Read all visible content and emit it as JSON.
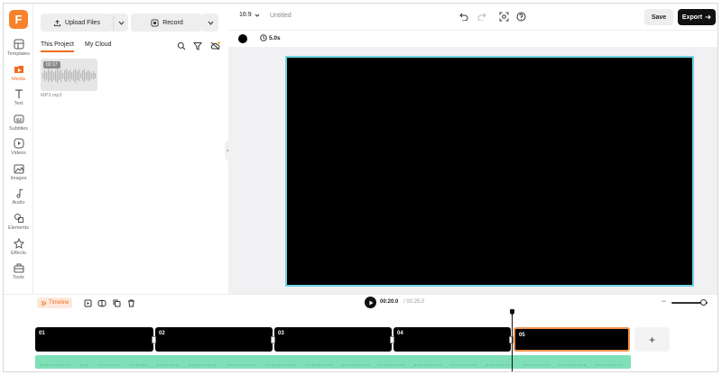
{
  "app": {
    "logo": "F"
  },
  "sidebar": {
    "items": [
      {
        "label": "Templates",
        "icon": "templates-icon"
      },
      {
        "label": "Media",
        "icon": "media-icon",
        "active": true
      },
      {
        "label": "Text",
        "icon": "text-icon"
      },
      {
        "label": "Subtitles",
        "icon": "subtitles-icon"
      },
      {
        "label": "Videos",
        "icon": "videos-icon"
      },
      {
        "label": "Images",
        "icon": "images-icon"
      },
      {
        "label": "Audio",
        "icon": "audio-icon"
      },
      {
        "label": "Elements",
        "icon": "elements-icon"
      },
      {
        "label": "Effects",
        "icon": "effects-icon"
      },
      {
        "label": "Tools",
        "icon": "tools-icon"
      }
    ]
  },
  "media_panel": {
    "upload_label": "Upload Files",
    "record_label": "Record",
    "tabs": [
      {
        "label": "This Project",
        "active": true
      },
      {
        "label": "My Cloud",
        "active": false
      }
    ],
    "items": [
      {
        "duration": "02:17",
        "name": "MP3.mp3"
      }
    ]
  },
  "topbar": {
    "aspect_ratio": "16:9",
    "project_title": "Untitled",
    "save_label": "Save",
    "export_label": "Export"
  },
  "canvas": {
    "duration": "5.0s",
    "background_color": "#000000",
    "selection_color": "#6fd3e6"
  },
  "timeline": {
    "label": "Timeline",
    "current_time": "00:20.0",
    "total_time": "/ 00:25.0",
    "zoom_minus": "−",
    "clips": [
      {
        "num": "01"
      },
      {
        "num": "02"
      },
      {
        "num": "03"
      },
      {
        "num": "04"
      },
      {
        "num": "05",
        "selected": true
      }
    ],
    "add_label": "+",
    "audio_color": "#7fe0b8"
  },
  "colors": {
    "accent": "#f36d21",
    "dark": "#111111"
  }
}
